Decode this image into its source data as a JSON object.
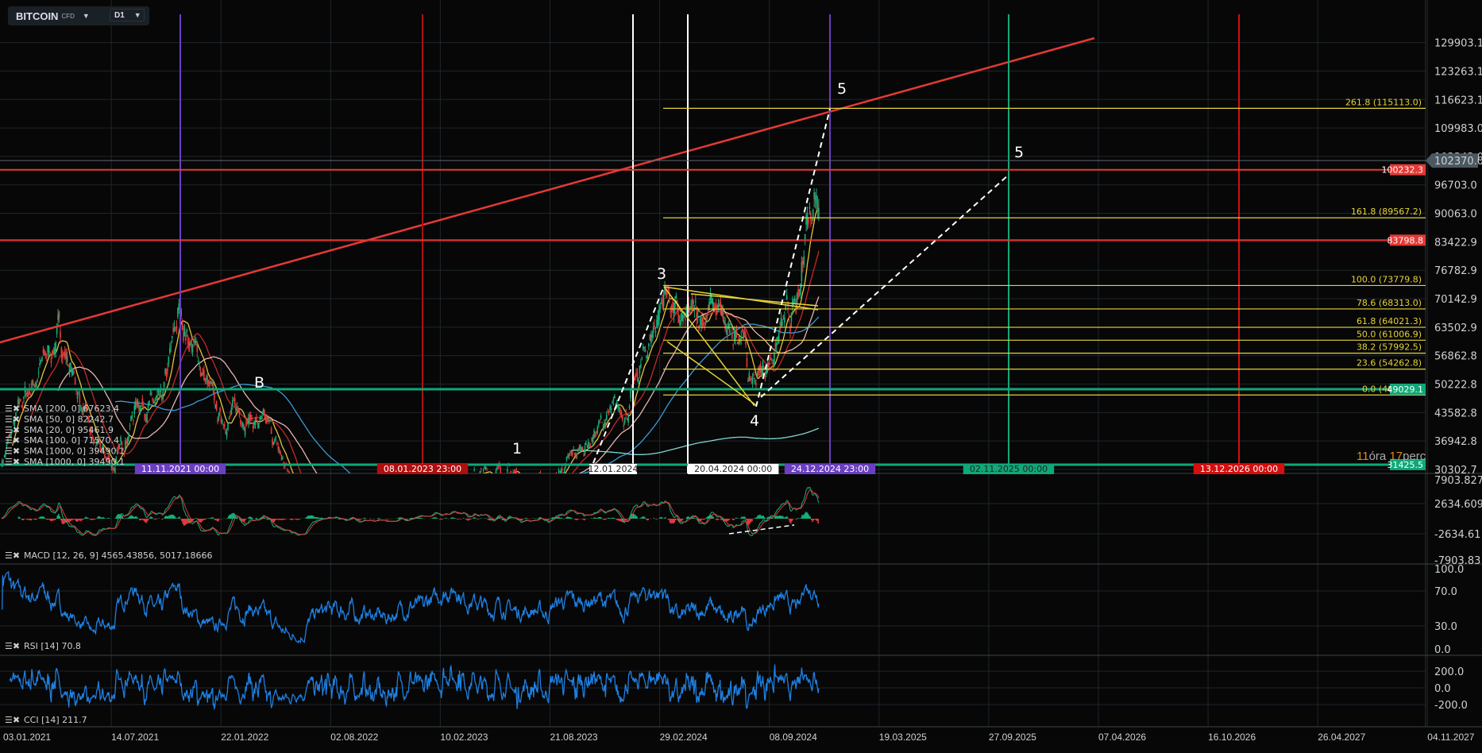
{
  "header": {
    "symbol": "BITCOIN",
    "type": "CFD",
    "timeframe": "D1"
  },
  "colors": {
    "bg": "#070707",
    "grid": "#1e262b",
    "up": "#16b07a",
    "down": "#e23b3b",
    "fib": "#e5d33a",
    "trend": "#e53935",
    "support": "#0fa878"
  },
  "price_axis": [
    "129903.1",
    "123263.1",
    "116623.1",
    "109983.0",
    "103343.0",
    "96703.0",
    "90063.0",
    "83422.9",
    "76782.9",
    "70142.9",
    "63502.9",
    "56862.8",
    "50222.8",
    "43582.8",
    "36942.8",
    "30302.7"
  ],
  "current_price": "102370.0",
  "price_tags": [
    {
      "label": "100232.3",
      "value": 100232.3,
      "kind": "resistance"
    },
    {
      "label": "83798.8",
      "value": 83798.8,
      "kind": "resistance"
    },
    {
      "label": "49029.1",
      "value": 49029.1,
      "kind": "support"
    },
    {
      "label": "31425.5",
      "value": 31425.5,
      "kind": "support"
    }
  ],
  "fib_levels": [
    {
      "label": "261.8 (115113.0)",
      "value": 115113.0
    },
    {
      "label": "161.8 (89567.2)",
      "value": 89567.2
    },
    {
      "label": "100.0 (73779.8)",
      "value": 73779.8
    },
    {
      "label": "78.6 (68313.0)",
      "value": 68313.0
    },
    {
      "label": "61.8 (64021.3)",
      "value": 64021.3
    },
    {
      "label": "50.0 (61006.9)",
      "value": 61006.9
    },
    {
      "label": "38.2 (57992.5)",
      "value": 57992.5
    },
    {
      "label": "23.6 (54262.8)",
      "value": 54262.8
    },
    {
      "label": "0.0 (48234.0)",
      "value": 48234.0
    }
  ],
  "vertical_markers": [
    {
      "label": "11.11.2021 00:00",
      "color": "#6a3fc1"
    },
    {
      "label": "08.01.2023 23:00",
      "color": "#b00f0f"
    },
    {
      "label": "12.01.2024",
      "color": "#ffffff"
    },
    {
      "label": "20.04.2024 00:00",
      "color": "#ffffff"
    },
    {
      "label": "24.12.2024 23:00",
      "color": "#6a3fc1"
    },
    {
      "label": "02.11.2025 00:00",
      "color": "#0fa878"
    },
    {
      "label": "13.12.2026 00:00",
      "color": "#d40f0f"
    }
  ],
  "wave_labels": [
    "1",
    "3",
    "4",
    "5",
    "5",
    "B"
  ],
  "indicators_legend": [
    "SMA [200, 0] 67623.4",
    "SMA [50, 0] 82242.7",
    "SMA [20, 0] 95461.9",
    "SMA [100, 0] 71570.4",
    "SMA [1000, 0] 39490.1",
    "SMA [1000, 0] 39490.1"
  ],
  "macd": {
    "legend": "MACD [12, 26, 9] 4565.43856,   5017.18666",
    "axis": [
      "7903.827",
      "2634.609",
      "-2634.61",
      "-7903.83"
    ]
  },
  "rsi": {
    "legend": "RSI [14] 70.8",
    "axis": [
      "100.0",
      "70.0",
      "30.0",
      "0.0"
    ]
  },
  "cci": {
    "legend": "CCI [14] 211.7",
    "axis": [
      "200.0",
      "0.0",
      "-200.0"
    ]
  },
  "date_axis": [
    "03.01.2021",
    "14.07.2021",
    "22.01.2022",
    "02.08.2022",
    "10.02.2023",
    "21.08.2023",
    "29.02.2024",
    "08.09.2024",
    "19.03.2025",
    "27.09.2025",
    "07.04.2026",
    "16.10.2026",
    "26.04.2027",
    "04.11.2027"
  ],
  "countdown": {
    "hours": "11",
    "hours_unit": "óra",
    "minutes": "17",
    "minutes_unit": "perc"
  }
}
